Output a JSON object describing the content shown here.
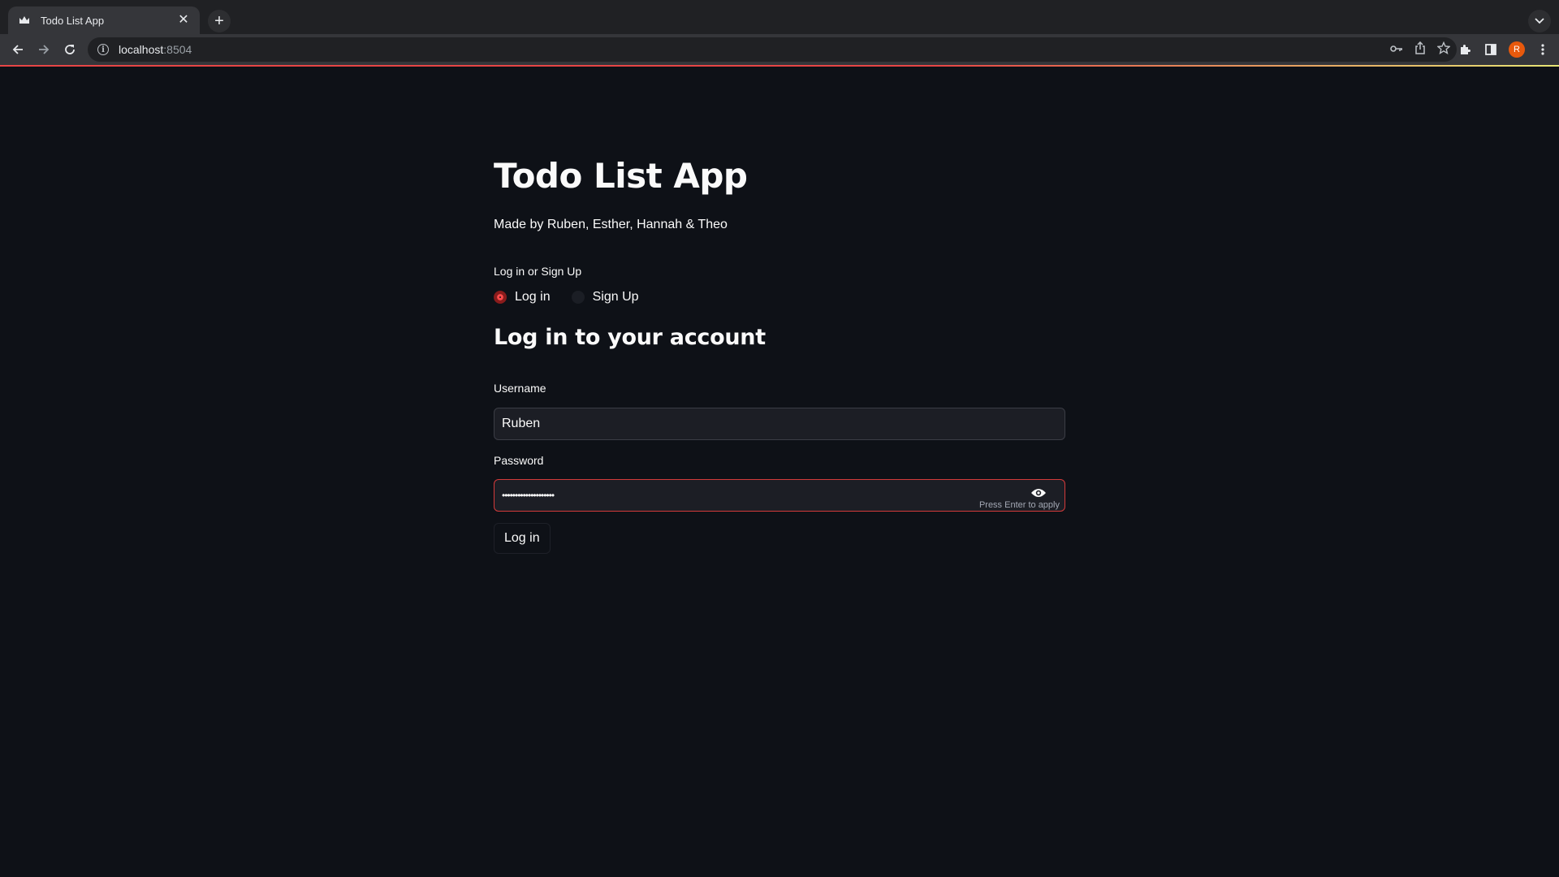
{
  "browser": {
    "tab_title": "Todo List App",
    "url_host": "localhost",
    "url_port": ":8504",
    "avatar_letter": "R",
    "avatar_color": "#e8590c"
  },
  "app": {
    "title": "Todo List App",
    "subtitle": "Made by Ruben, Esther, Hannah & Theo",
    "mode_label": "Log in or Sign Up",
    "mode_options": [
      "Log in",
      "Sign Up"
    ],
    "mode_selected": "Log in",
    "heading": "Log in to your account",
    "username_label": "Username",
    "username_value": "Ruben",
    "password_label": "Password",
    "password_mask": "••••••••••••••••••••",
    "password_hint": "Press Enter to apply",
    "login_button": "Log in",
    "accent_color": "#ff4b4b"
  }
}
